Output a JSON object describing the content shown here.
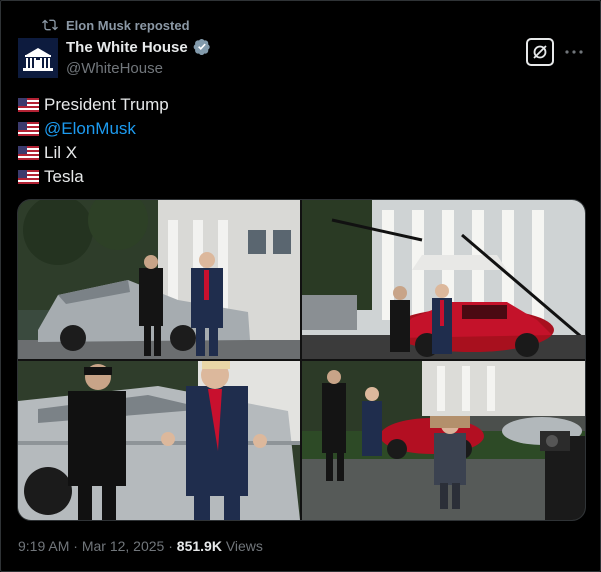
{
  "repost": {
    "label": "Elon Musk reposted",
    "icon": "repost-icon"
  },
  "author": {
    "name": "The White House",
    "handle": "@WhiteHouse",
    "verified_color": "#829aab"
  },
  "post": {
    "lines": [
      {
        "flag": "us-flag-emoji",
        "text": "President Trump"
      },
      {
        "flag": "us-flag-emoji",
        "text": "@ElonMusk",
        "is_mention": true
      },
      {
        "flag": "us-flag-emoji",
        "text": "Lil X"
      },
      {
        "flag": "us-flag-emoji",
        "text": "Tesla"
      }
    ]
  },
  "media": {
    "photos": [
      {
        "alt": "President Trump and Elon Musk standing beside a silver Cybertruck at the White House"
      },
      {
        "alt": "Musk and Trump next to a red Tesla Model 3 on the White House driveway"
      },
      {
        "alt": "Close-up of Musk and Trump gesturing beside the Cybertruck"
      },
      {
        "alt": "A child in a gray coat walking near a red Tesla while photographers look on"
      }
    ]
  },
  "meta": {
    "time": "9:19 AM",
    "sep": " · ",
    "date": "Mar 12, 2025",
    "sep2": " · ",
    "views_count": "851.9K",
    "views_label": " Views"
  },
  "colors": {
    "background": "#000000",
    "text": "#e7e9ea",
    "muted": "#71767b",
    "link": "#1d9bf0"
  }
}
